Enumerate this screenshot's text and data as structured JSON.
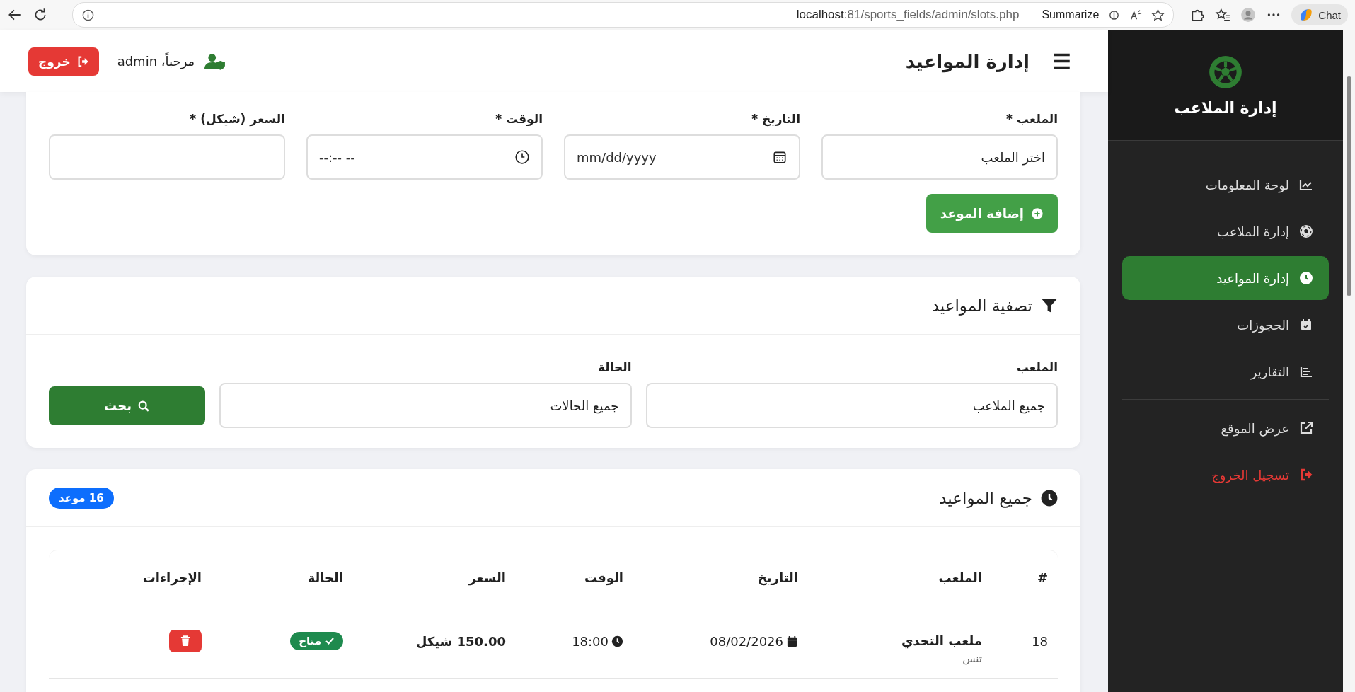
{
  "browser": {
    "url_host": "localhost",
    "url_path": ":81/sports_fields/admin/slots.php",
    "summarize": "Summarize",
    "chat": "Chat"
  },
  "sidebar": {
    "title": "إدارة الملاعب",
    "items": [
      {
        "label": "لوحة المعلومات",
        "selected": false
      },
      {
        "label": "إدارة الملاعب",
        "selected": false
      },
      {
        "label": "إدارة المواعيد",
        "selected": true
      },
      {
        "label": "الحجوزات",
        "selected": false
      },
      {
        "label": "التقارير",
        "selected": false
      }
    ],
    "footer_items": [
      {
        "label": "عرض الموقع",
        "kind": "link"
      },
      {
        "label": "تسجيل الخروج",
        "kind": "logout"
      }
    ]
  },
  "header": {
    "title": "إدارة المواعيد",
    "welcome": "مرحباً، admin",
    "logout": "خروج"
  },
  "add_form": {
    "fields": [
      {
        "label": "الملعب *",
        "kind": "select",
        "value": "اختر الملعب"
      },
      {
        "label": "التاريخ *",
        "kind": "date",
        "placeholder": "mm/dd/yyyy"
      },
      {
        "label": "الوقت *",
        "kind": "time",
        "placeholder": "--:-- --"
      },
      {
        "label": "السعر (شيكل) *",
        "kind": "number"
      }
    ],
    "button": "إضافة الموعد"
  },
  "filter": {
    "title": "تصفية المواعيد",
    "fields": [
      {
        "label": "الملعب",
        "value": "جميع الملاعب"
      },
      {
        "label": "الحالة",
        "value": "جميع الحالات"
      }
    ],
    "button": "بحث"
  },
  "slots": {
    "title": "جميع المواعيد",
    "count": "16 موعد",
    "columns": [
      "#",
      "الملعب",
      "التاريخ",
      "الوقت",
      "السعر",
      "الحالة",
      "الإجراءات"
    ],
    "rows": [
      {
        "number": "18",
        "field": "ملعب التحدي",
        "sport": "تنس",
        "date": "08/02/2026",
        "time": "18:00",
        "price": "150.00 شيكل",
        "status": "متاح",
        "kind": "available"
      }
    ]
  }
}
